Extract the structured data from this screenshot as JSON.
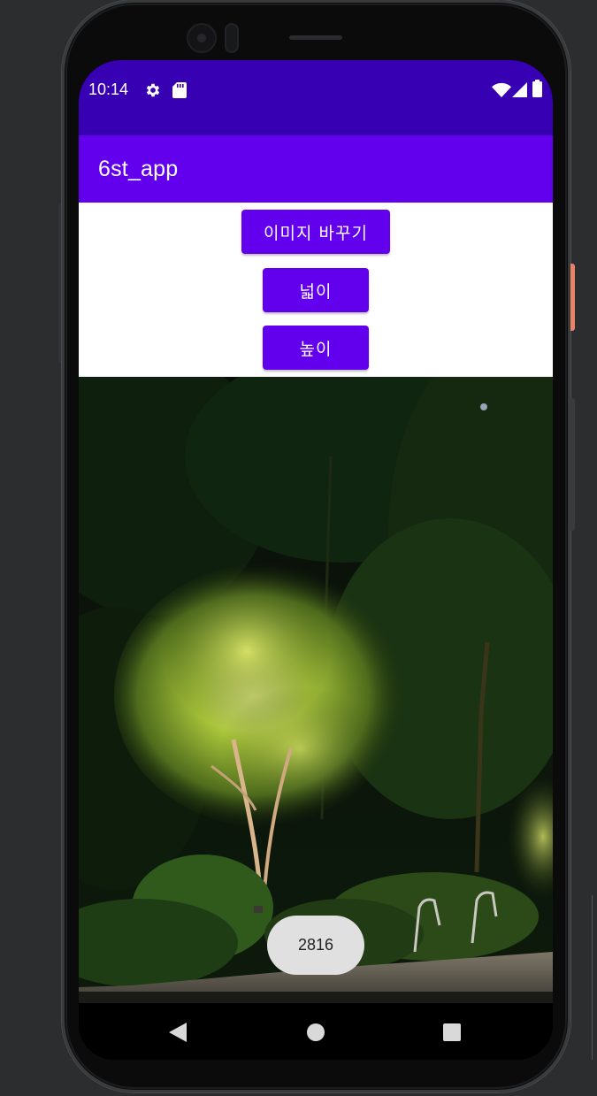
{
  "status_bar": {
    "time": "10:14",
    "left_icons": [
      "gear-icon",
      "sd-card-icon"
    ],
    "right_icons": [
      "wifi-icon",
      "signal-icon",
      "battery-icon"
    ],
    "color": "#3700b3"
  },
  "app_bar": {
    "title": "6st_app",
    "color": "#6200ee"
  },
  "buttons": {
    "change_image": "이미지 바꾸기",
    "width": "넓이",
    "height": "높이",
    "color": "#6200ee"
  },
  "image": {
    "subject": "night-lit tree in garden"
  },
  "toast": {
    "text": "2816"
  },
  "nav_bar": {
    "icons": [
      "back-icon",
      "home-icon",
      "recents-icon"
    ]
  }
}
